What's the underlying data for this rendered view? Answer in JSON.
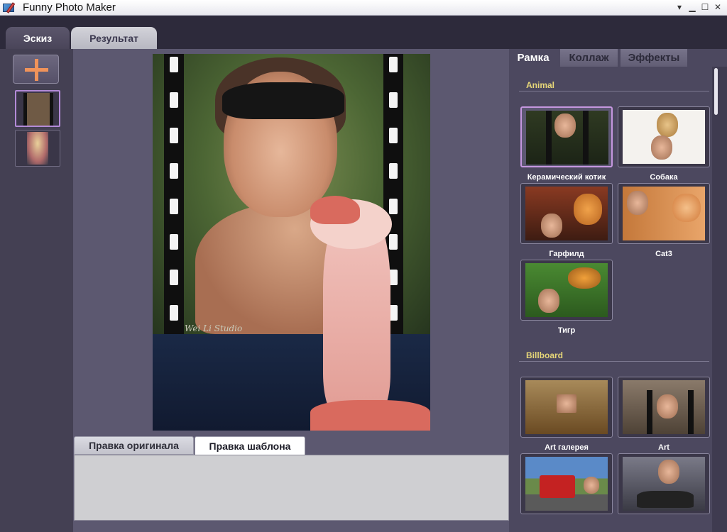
{
  "window": {
    "title": "Funny Photo Maker",
    "controls": [
      "▾",
      "▁",
      "☐",
      "✕"
    ]
  },
  "main_tabs": [
    {
      "label": "Эскиз",
      "active": true
    },
    {
      "label": "Результат",
      "active": false
    }
  ],
  "left_panel": {
    "add_button_icon": "plus-icon",
    "thumbnails": [
      {
        "selected": true
      },
      {
        "selected": false
      }
    ]
  },
  "canvas": {
    "watermark": "Wei Li Studio"
  },
  "edit_tabs": [
    {
      "label": "Правка оригинала",
      "active": false
    },
    {
      "label": "Правка шаблона",
      "active": true
    }
  ],
  "right_panel": {
    "tabs": [
      {
        "label": "Рамка",
        "active": true
      },
      {
        "label": "Коллаж",
        "active": false
      },
      {
        "label": "Эффекты",
        "active": false
      }
    ],
    "sections": [
      {
        "title": "Animal",
        "items": [
          {
            "label": "Керамический котик",
            "selected": true,
            "color": "#2f3a22"
          },
          {
            "label": "Собака",
            "selected": false,
            "color": "#f4f2ee"
          },
          {
            "label": "Гарфилд",
            "selected": false,
            "color": "#7a3d1e"
          },
          {
            "label": "Cat3",
            "selected": false,
            "color": "#d58a4c"
          },
          {
            "label": "Тигр",
            "selected": false,
            "color": "#3f7a2c"
          }
        ]
      },
      {
        "title": "Billboard",
        "items": [
          {
            "label": "Art галерея",
            "selected": false,
            "color": "#8a6a3a"
          },
          {
            "label": "Art",
            "selected": false,
            "color": "#7a6a5a"
          },
          {
            "label": "",
            "selected": false,
            "color": "#4a79b8"
          },
          {
            "label": "",
            "selected": false,
            "color": "#5a5a66"
          }
        ]
      }
    ]
  },
  "colors": {
    "accent_purple": "#b38ad8",
    "section_title": "#e6d678",
    "plus": "#f0935a"
  }
}
